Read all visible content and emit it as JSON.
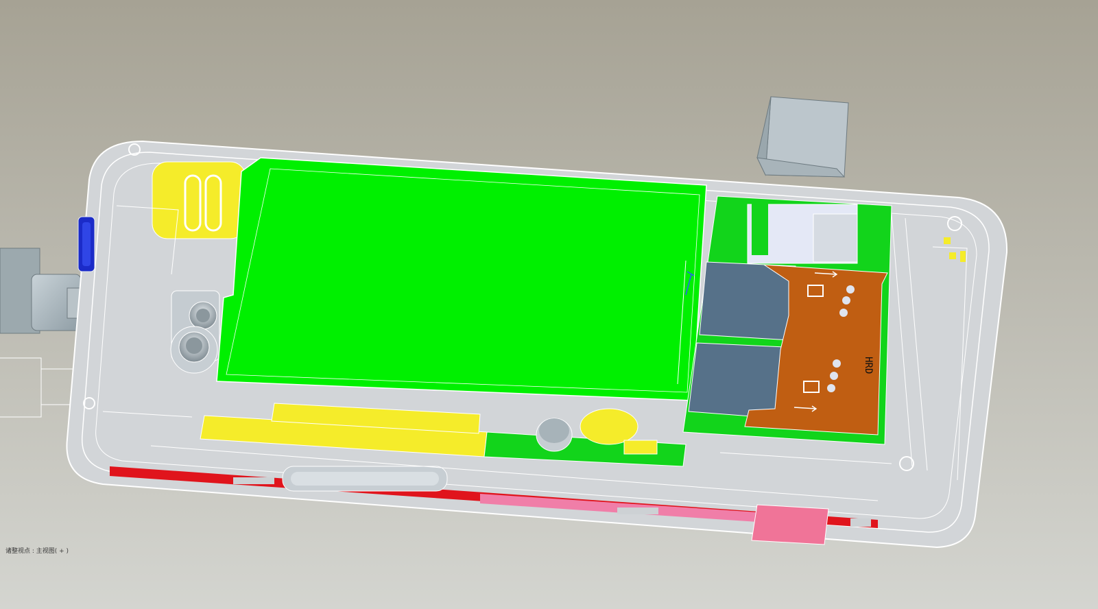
{
  "viewport": {
    "background_top": "#a6a294",
    "background_bottom": "#d4d5d0"
  },
  "colors": {
    "shell_fill": "#d2d5d8",
    "shell_line": "#ffffff",
    "battery": "#00f000",
    "pcb_green": "#12d41b",
    "speaker_yellow": "#f5ec2a",
    "sim_tray": "#c05e12",
    "sim_card": "#567189",
    "connector_gray": "#b4c2c9",
    "usb_pink": "#f07498",
    "red_band": "#e0141c",
    "side_key_blue": "#1b2bc8"
  },
  "icons": {
    "status": "none"
  },
  "board": {
    "sim_label": "HRD"
  },
  "status_bar": {
    "text": "诸整视点 : 主视图( + )"
  }
}
